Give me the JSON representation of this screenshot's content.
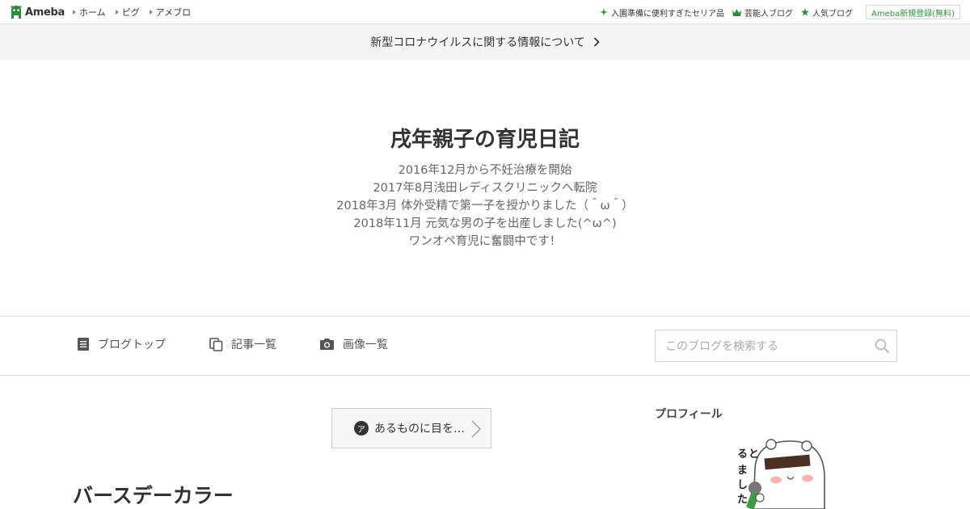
{
  "global_header": {
    "logo_text": "Ameba",
    "nav": [
      {
        "label": "ホーム"
      },
      {
        "label": "ピグ"
      },
      {
        "label": "アメブロ"
      }
    ],
    "right_links": [
      {
        "label": "入園準備に便利すぎたセリア品",
        "icon": "sparkle-icon"
      },
      {
        "label": "芸能人ブログ",
        "icon": "crown-icon"
      },
      {
        "label": "人気ブログ",
        "icon": "star-icon"
      }
    ],
    "register_label": "Ameba新規登録(無料)",
    "accent_color": "#2d8c3c"
  },
  "notice": {
    "text": "新型コロナウイルスに関する情報について"
  },
  "blog": {
    "title": "戌年親子の育児日記",
    "description_lines": [
      "2016年12月から不妊治療を開始",
      "2017年8月浅田レディスクリニックへ転院",
      "2018年3月 体外受精で第一子を授かりました（＾ω＾）",
      "2018年11月 元気な男の子を出産しました(^ω^)",
      "ワンオペ育児に奮闘中です！"
    ]
  },
  "blog_nav": {
    "items": [
      {
        "label": "ブログトップ",
        "icon": "document-icon"
      },
      {
        "label": "記事一覧",
        "icon": "copy-icon"
      },
      {
        "label": "画像一覧",
        "icon": "camera-icon"
      }
    ],
    "search_placeholder": "このブログを検索する"
  },
  "main": {
    "theme_badge": "ア",
    "theme_label": "あるものに目を…",
    "entry_title": "バースデーカラー"
  },
  "sidebar": {
    "profile_heading": "プロフィール",
    "sticker_text": "るとました"
  }
}
